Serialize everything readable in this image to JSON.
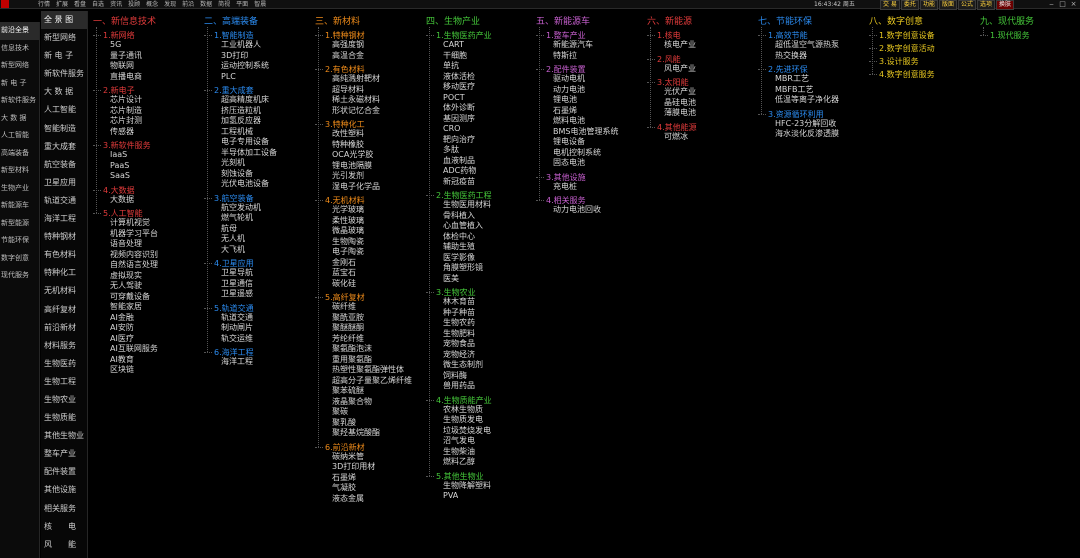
{
  "topbar": {
    "menu": [
      "行情",
      "扩展",
      "看盘",
      "自选",
      "资讯",
      "投顾",
      "概念",
      "发现",
      "前沿",
      "数据",
      "简视",
      "平面",
      "智晨"
    ],
    "clock": "16:43:42 周五",
    "trade_buttons": [
      "交 易",
      "委托",
      "功能",
      "版面",
      "公式",
      "选项",
      "换肤"
    ],
    "window_controls": [
      "‒",
      "□",
      "×"
    ]
  },
  "sidebar_outer": {
    "items": [
      "前沿全景",
      "信息技术",
      "新型网络",
      "新 电 子",
      "新软件服务",
      "大 数 据",
      "人工智能",
      "高端装备",
      "新型材料",
      "生物产业",
      "新能源车",
      "新型能源",
      "节能环保",
      "数字创意",
      "现代服务"
    ],
    "selected_index": 0
  },
  "sidebar_inner": {
    "items": [
      "全 景 图",
      "新型网络",
      "新 电 子",
      "新软件服务",
      "大 数 据",
      "人工智能",
      "智能制造",
      "重大成套",
      "航空装备",
      "卫星应用",
      "轨道交通",
      "海洋工程",
      "特种钢材",
      "有色材料",
      "特种化工",
      "无机材料",
      "高纤复材",
      "前沿新材",
      "材料服务",
      "生物医药",
      "生物工程",
      "生物农业",
      "生物质能",
      "其他生物业",
      "整车产业",
      "配件装置",
      "其他设施",
      "相关服务",
      "核　　电",
      "风　　能"
    ],
    "selected_index": 0
  },
  "colors": {
    "category": "#e23b3b",
    "sub_red": "#e23b3b",
    "sub_orange": "#f08c1a",
    "sub_blue": "#2b8bf0",
    "sub_green": "#45c83a",
    "sub_purple": "#c860d0",
    "sub_yellow": "#e8c820",
    "item": "#d8d8d8"
  },
  "columns": [
    {
      "title": "一、新信息技术",
      "title_color": "#e23b3b",
      "subs": [
        {
          "label": "1.新网络",
          "color": "#e23b3b",
          "items": [
            "5G",
            "量子通讯",
            "物联网",
            "直播电商"
          ]
        },
        {
          "label": "2.新电子",
          "color": "#e23b3b",
          "items": [
            "芯片设计",
            "芯片制造",
            "芯片封测",
            "传感器"
          ]
        },
        {
          "label": "3.新软件服务",
          "color": "#e23b3b",
          "items": [
            "IaaS",
            "PaaS",
            "SaaS"
          ]
        },
        {
          "label": "4.大数据",
          "color": "#e23b3b",
          "items": [
            "大数据"
          ]
        },
        {
          "label": "5.人工智能",
          "color": "#e23b3b",
          "items": [
            "计算机视觉",
            "机器学习平台",
            "语音处理",
            "视频内容识别",
            "自然语言处理",
            "虚拟现实",
            "无人驾驶",
            "可穿戴设备",
            "智能家居",
            "AI金融",
            "AI安防",
            "AI医疗",
            "AI互联网服务",
            "AI教育",
            "区块链"
          ]
        }
      ]
    },
    {
      "title": "二、高端装备",
      "title_color": "#2b8bf0",
      "subs": [
        {
          "label": "1.智能制造",
          "color": "#2b8bf0",
          "items": [
            "工业机器人",
            "3D打印",
            "运动控制系统",
            "PLC"
          ]
        },
        {
          "label": "2.重大成套",
          "color": "#2b8bf0",
          "items": [
            "超高精度机床",
            "挤压造粒机",
            "加氢反应器",
            "工程机械",
            "电子专用设备",
            "半导体加工设备",
            "光刻机",
            "刻蚀设备",
            "光伏电池设备"
          ]
        },
        {
          "label": "3.航空装备",
          "color": "#2b8bf0",
          "items": [
            "航空发动机",
            "燃气轮机",
            "航母",
            "无人机",
            "大飞机"
          ]
        },
        {
          "label": "4.卫星应用",
          "color": "#2b8bf0",
          "items": [
            "卫星导航",
            "卫星通信",
            "卫星遥感"
          ]
        },
        {
          "label": "5.轨道交通",
          "color": "#2b8bf0",
          "items": [
            "轨道交通",
            "制动闸片",
            "轨交运维"
          ]
        },
        {
          "label": "6.海洋工程",
          "color": "#2b8bf0",
          "items": [
            "海洋工程"
          ]
        }
      ]
    },
    {
      "title": "三、新材料",
      "title_color": "#f08c1a",
      "subs": [
        {
          "label": "1.特种钢材",
          "color": "#f08c1a",
          "items": [
            "高强度钢",
            "高温合金"
          ]
        },
        {
          "label": "2.有色材料",
          "color": "#f08c1a",
          "items": [
            "高纯溅射靶材",
            "超导材料",
            "稀土永磁材料",
            "形状记忆合金"
          ]
        },
        {
          "label": "3.特种化工",
          "color": "#f08c1a",
          "items": [
            "改性塑料",
            "特种橡胶",
            "OCA光学胶",
            "锂电池隔膜",
            "光引发剂",
            "湿电子化学品"
          ]
        },
        {
          "label": "4.无机材料",
          "color": "#f08c1a",
          "items": [
            "光学玻璃",
            "柔性玻璃",
            "微晶玻璃",
            "生物陶瓷",
            "电子陶瓷",
            "金刚石",
            "蓝宝石",
            "碳化硅"
          ]
        },
        {
          "label": "5.高纤复材",
          "color": "#f08c1a",
          "items": [
            "碳纤维",
            "聚酰亚胺",
            "聚醚醚酮",
            "芳纶纤维",
            "聚氨酯泡沫",
            "重用聚氨酯",
            "热塑性聚氨酯弹性体",
            "超高分子量聚乙烯纤维",
            "聚苯硫醚",
            "液晶聚合物",
            "聚碳",
            "聚乳酸",
            "聚羟基烷酸酯"
          ]
        },
        {
          "label": "6.前沿新材",
          "color": "#f08c1a",
          "items": [
            "碳纳米管",
            "3D打印用材",
            "石墨烯",
            "气凝胶",
            "液态金属"
          ]
        }
      ]
    },
    {
      "title": "四、生物产业",
      "title_color": "#45c83a",
      "subs": [
        {
          "label": "1.生物医药产业",
          "color": "#45c83a",
          "items": [
            "CART",
            "干细胞",
            "单抗",
            "液体活检",
            "移动医疗",
            "POCT",
            "体外诊断",
            "基因测序",
            "CRO",
            "靶向治疗",
            "多肽",
            "血液制品",
            "ADC药物",
            "新冠疫苗"
          ]
        },
        {
          "label": "2.生物医药工程",
          "color": "#45c83a",
          "items": [
            "生物医用材料",
            "骨科植入",
            "心血管植入",
            "体检中心",
            "辅助生殖",
            "医学影像",
            "角膜塑形镜",
            "医美"
          ]
        },
        {
          "label": "3.生物农业",
          "color": "#45c83a",
          "items": [
            "林木育苗",
            "种子种苗",
            "生物农药",
            "生物肥料",
            "宠物食品",
            "宠物经济",
            "微生态制剂",
            "饲料酶",
            "兽用药品"
          ]
        },
        {
          "label": "4.生物质能产业",
          "color": "#45c83a",
          "items": [
            "农林生物质",
            "生物质发电",
            "垃圾焚烧发电",
            "沼气发电",
            "生物柴油",
            "燃料乙醇"
          ]
        },
        {
          "label": "5.其他生物业",
          "color": "#45c83a",
          "items": [
            "生物降解塑料",
            "PVA"
          ]
        }
      ]
    },
    {
      "title": "五、新能源车",
      "title_color": "#c860d0",
      "subs": [
        {
          "label": "1.整车产业",
          "color": "#c860d0",
          "items": [
            "新能源汽车",
            "特斯拉"
          ]
        },
        {
          "label": "2.配件装置",
          "color": "#c860d0",
          "items": [
            "驱动电机",
            "动力电池",
            "锂电池",
            "石墨烯",
            "燃料电池",
            "BMS电池管理系统",
            "锂电设备",
            "电机控制系统",
            "固态电池"
          ]
        },
        {
          "label": "3.其他设施",
          "color": "#c860d0",
          "items": [
            "充电桩"
          ]
        },
        {
          "label": "4.相关服务",
          "color": "#c860d0",
          "items": [
            "动力电池回收"
          ]
        }
      ]
    },
    {
      "title": "六、新能源",
      "title_color": "#e23b3b",
      "subs": [
        {
          "label": "1.核电",
          "color": "#e23b3b",
          "items": [
            "核电产业"
          ]
        },
        {
          "label": "2.风能",
          "color": "#e23b3b",
          "items": [
            "风电产业"
          ]
        },
        {
          "label": "3.太阳能",
          "color": "#e23b3b",
          "items": [
            "光伏产业",
            "晶硅电池",
            "薄膜电池"
          ]
        },
        {
          "label": "4.其他能源",
          "color": "#e23b3b",
          "items": [
            "可燃冰"
          ]
        }
      ]
    },
    {
      "title": "七、节能环保",
      "title_color": "#2b8bf0",
      "subs": [
        {
          "label": "1.高效节能",
          "color": "#2b8bf0",
          "items": [
            "超低温空气源热泵",
            "热交换器"
          ]
        },
        {
          "label": "2.先进环保",
          "color": "#2b8bf0",
          "items": [
            "MBR工艺",
            "MBFB工艺",
            "低温等离子净化器"
          ]
        },
        {
          "label": "3.资源循环利用",
          "color": "#2b8bf0",
          "items": [
            "HFC-23分解回收",
            "海水淡化反渗透膜"
          ]
        }
      ]
    },
    {
      "title": "八、数字创意",
      "title_color": "#e8c820",
      "subs": [
        {
          "label": "1.数字创意设备",
          "color": "#e8c820",
          "items": []
        },
        {
          "label": "2.数字创意活动",
          "color": "#e8c820",
          "items": []
        },
        {
          "label": "3.设计服务",
          "color": "#e8c820",
          "items": []
        },
        {
          "label": "4.数字创意服务",
          "color": "#e8c820",
          "items": []
        }
      ]
    },
    {
      "title": "九、现代服务",
      "title_color": "#45c83a",
      "subs": [
        {
          "label": "1.现代服务",
          "color": "#45c83a",
          "items": []
        }
      ]
    }
  ]
}
